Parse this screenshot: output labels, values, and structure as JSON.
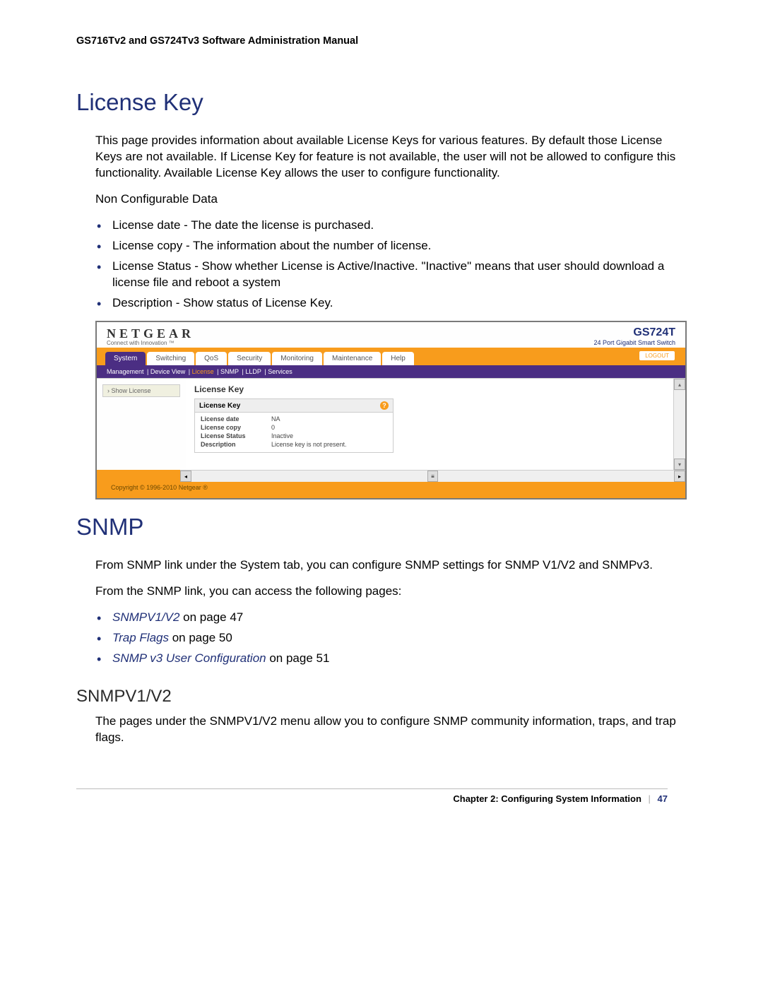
{
  "doc_header": "GS716Tv2 and GS724Tv3 Software Administration Manual",
  "section1_title": "License Key",
  "section1_para": "This page provides information about available License Keys for various features. By default those License Keys are not available. If License Key for feature is not available, the user will not be allowed to configure this functionality. Available License Key allows the user to configure functionality.",
  "nonconfig_label": "Non Configurable Data",
  "bullets1": {
    "b0": "License date - The date the license is purchased.",
    "b1": "License copy - The information about the number of license.",
    "b2": "License Status - Show whether License is Active/Inactive. \"Inactive\" means that user should download a license file and reboot a system",
    "b3": "Description - Show status of License Key."
  },
  "screenshot": {
    "brand": "NETGEAR",
    "brand_sub": "Connect with Innovation ™",
    "model": "GS724T",
    "model_sub": "24 Port Gigabit Smart Switch",
    "tabs": {
      "t0": "System",
      "t1": "Switching",
      "t2": "QoS",
      "t3": "Security",
      "t4": "Monitoring",
      "t5": "Maintenance",
      "t6": "Help"
    },
    "logout": "LOGOUT",
    "submenu": {
      "s0": "Management",
      "s1": "Device View",
      "s2": "License",
      "s3": "SNMP",
      "s4": "LLDP",
      "s5": "Services"
    },
    "sidebar_item": "› Show License",
    "main_title": "License Key",
    "panel_header": "License Key",
    "rows": {
      "r0l": "License date",
      "r0v": "NA",
      "r1l": "License copy",
      "r1v": "0",
      "r2l": "License Status",
      "r2v": "Inactive",
      "r3l": "Description",
      "r3v": "License key is not present."
    },
    "copyright": "Copyright © 1996-2010 Netgear ®"
  },
  "section2_title": "SNMP",
  "section2_para1": "From SNMP link under the System tab, you can configure SNMP settings for SNMP V1/V2 and SNMPv3.",
  "section2_para2": "From the SNMP link, you can access the following pages:",
  "bullets2": {
    "b0_link": "SNMPV1/V2",
    "b0_rest": " on page 47",
    "b1_link": "Trap Flags",
    "b1_rest": " on page 50",
    "b2_link": "SNMP v3 User Configuration",
    "b2_rest": " on page 51"
  },
  "subsection_title": "SNMPV1/V2",
  "subsection_para": "The pages under the SNMPV1/V2 menu allow you to configure SNMP community information, traps, and trap flags.",
  "footer_chapter": "Chapter 2:  Configuring System Information",
  "footer_page": "47"
}
